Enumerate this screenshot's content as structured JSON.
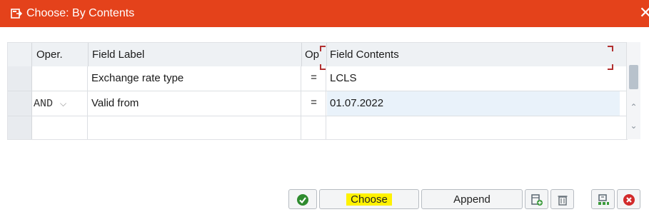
{
  "window": {
    "title": "Choose: By Contents",
    "close_glyph": "✕",
    "accent": "#e4421b"
  },
  "grid": {
    "headers": {
      "oper": "Oper.",
      "field_label": "Field Label",
      "op": "Op",
      "field_contents": "Field Contents"
    },
    "rows": [
      {
        "oper": "",
        "field_label": "Exchange rate type",
        "op": "=",
        "field_contents": "LCLS"
      },
      {
        "oper": "AND",
        "field_label": "Valid from",
        "op": "=",
        "field_contents": "01.07.2022"
      },
      {
        "oper": "",
        "field_label": "",
        "op": "",
        "field_contents": ""
      }
    ]
  },
  "toolbar": {
    "choose_label": "Choose",
    "append_label": "Append",
    "icons": [
      "confirm-check-icon",
      "insert-row-icon",
      "delete-trash-icon",
      "hierarchy-icon",
      "cancel-icon"
    ]
  }
}
